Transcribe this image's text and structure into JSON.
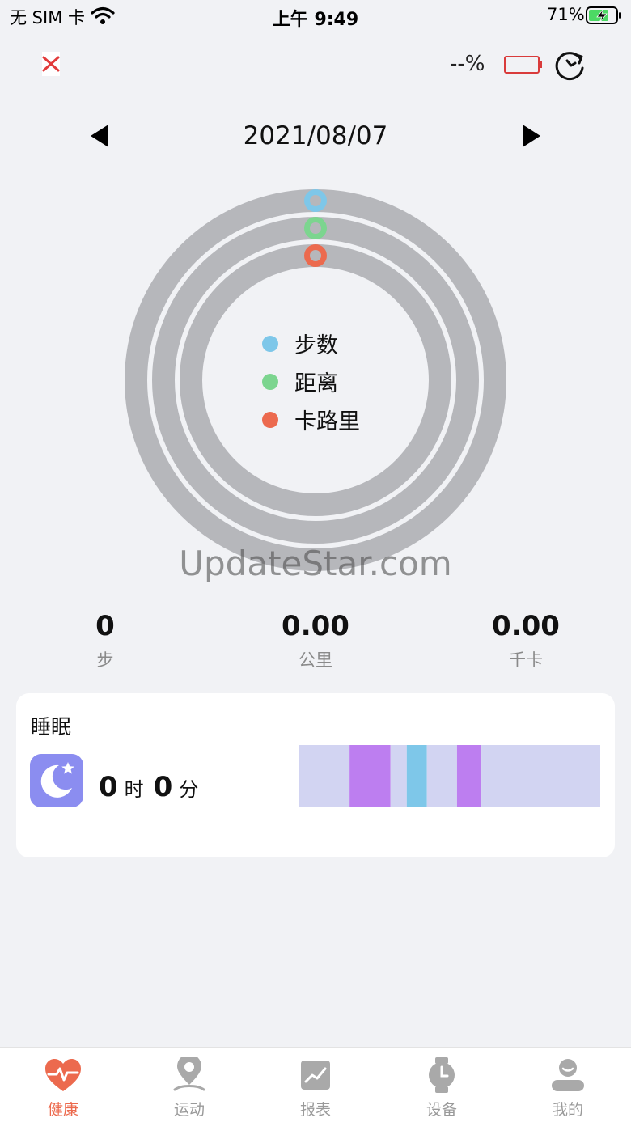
{
  "status_bar": {
    "carrier": "无 SIM 卡",
    "time": "上午 9:49",
    "battery_percent": "71%"
  },
  "header": {
    "watch_battery_text": "--%",
    "icons": [
      "close-icon",
      "watch-battery-icon",
      "sync-icon"
    ]
  },
  "date_nav": {
    "date": "2021/08/07"
  },
  "rings": {
    "legend": [
      {
        "label": "步数",
        "color": "#7ec7e9"
      },
      {
        "label": "距离",
        "color": "#7cd58f"
      },
      {
        "label": "卡路里",
        "color": "#ec6a4e"
      }
    ],
    "track_color": "#b6b7bb",
    "progress": {
      "steps": 0,
      "distance": 0,
      "calories": 0
    }
  },
  "watermark": "UpdateStar.com",
  "stats": [
    {
      "value": "0",
      "unit": "步"
    },
    {
      "value": "0.00",
      "unit": "公里"
    },
    {
      "value": "0.00",
      "unit": "千卡"
    }
  ],
  "sleep": {
    "title": "睡眠",
    "hours": "0",
    "hours_unit": "时",
    "minutes": "0",
    "minutes_unit": "分",
    "icon": "moon-star-icon",
    "icon_color": "#8b8df0",
    "colors": {
      "awake": "#d2d4f2",
      "deep": "#bd7ef0",
      "light": "#7ec7e9"
    },
    "segments": [
      {
        "stage": "awake",
        "from": 0.0,
        "to": 0.167
      },
      {
        "stage": "deep",
        "from": 0.167,
        "to": 0.303
      },
      {
        "stage": "awake",
        "from": 0.303,
        "to": 0.357
      },
      {
        "stage": "light",
        "from": 0.357,
        "to": 0.424
      },
      {
        "stage": "awake",
        "from": 0.424,
        "to": 0.524
      },
      {
        "stage": "deep",
        "from": 0.524,
        "to": 0.605
      },
      {
        "stage": "awake",
        "from": 0.605,
        "to": 1.0
      }
    ]
  },
  "tabs": [
    {
      "label": "健康",
      "icon": "heart-pulse-icon",
      "active": true
    },
    {
      "label": "运动",
      "icon": "location-pin-icon",
      "active": false
    },
    {
      "label": "报表",
      "icon": "chart-report-icon",
      "active": false
    },
    {
      "label": "设备",
      "icon": "watch-icon",
      "active": false
    },
    {
      "label": "我的",
      "icon": "user-profile-icon",
      "active": false
    }
  ],
  "accent_color": "#ec6a4e"
}
